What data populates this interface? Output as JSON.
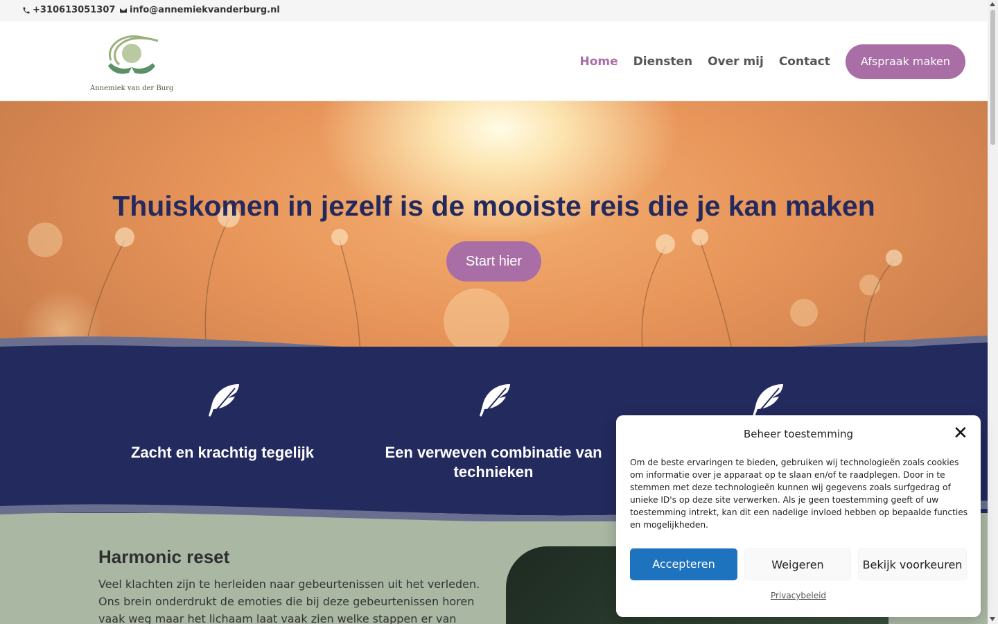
{
  "topbar": {
    "phone": "+310613051307",
    "email": "info@annemiekvanderburg.nl",
    "phone_icon": "phone-icon",
    "email_icon": "envelope-icon"
  },
  "header": {
    "logo_text": "Annemiek van der Burg",
    "nav": {
      "home": "Home",
      "diensten": "Diensten",
      "over_mij": "Over mij",
      "contact": "Contact",
      "cta": "Afspraak maken"
    }
  },
  "hero": {
    "title": "Thuiskomen in jezelf is de mooiste reis die je kan maken",
    "button": "Start hier"
  },
  "features": [
    {
      "icon": "feather-icon",
      "title": "Zacht en krachtig tegelijk"
    },
    {
      "icon": "feather-icon",
      "title": "Een verweven combinatie van technieken"
    },
    {
      "icon": "feather-icon",
      "title": ""
    }
  ],
  "section": {
    "heading": "Harmonic reset",
    "text": "Veel klachten zijn te herleiden naar gebeurtenissen uit het verleden. Ons brein onderdrukt de emoties die bij deze gebeurtenissen horen vaak weg maar het lichaam laat vaak zien welke stappen er van"
  },
  "consent": {
    "title": "Beheer toestemming",
    "body": "Om de beste ervaringen te bieden, gebruiken wij technologieën zoals cookies om informatie over je apparaat op te slaan en/of te raadplegen. Door in te stemmen met deze technologieën kunnen wij gegevens zoals surfgedrag of unieke ID's op deze site verwerken. Als je geen toestemming geeft of uw toestemming intrekt, kan dit een nadelige invloed hebben op bepaalde functies en mogelijkheden.",
    "accept": "Accepteren",
    "deny": "Weigeren",
    "preferences": "Bekijk voorkeuren",
    "privacy": "Privacybeleid"
  },
  "colors": {
    "accent": "#a86ea5",
    "navy": "#232a5e",
    "sage": "#a9b7a3",
    "primary_button": "#1e73be"
  }
}
